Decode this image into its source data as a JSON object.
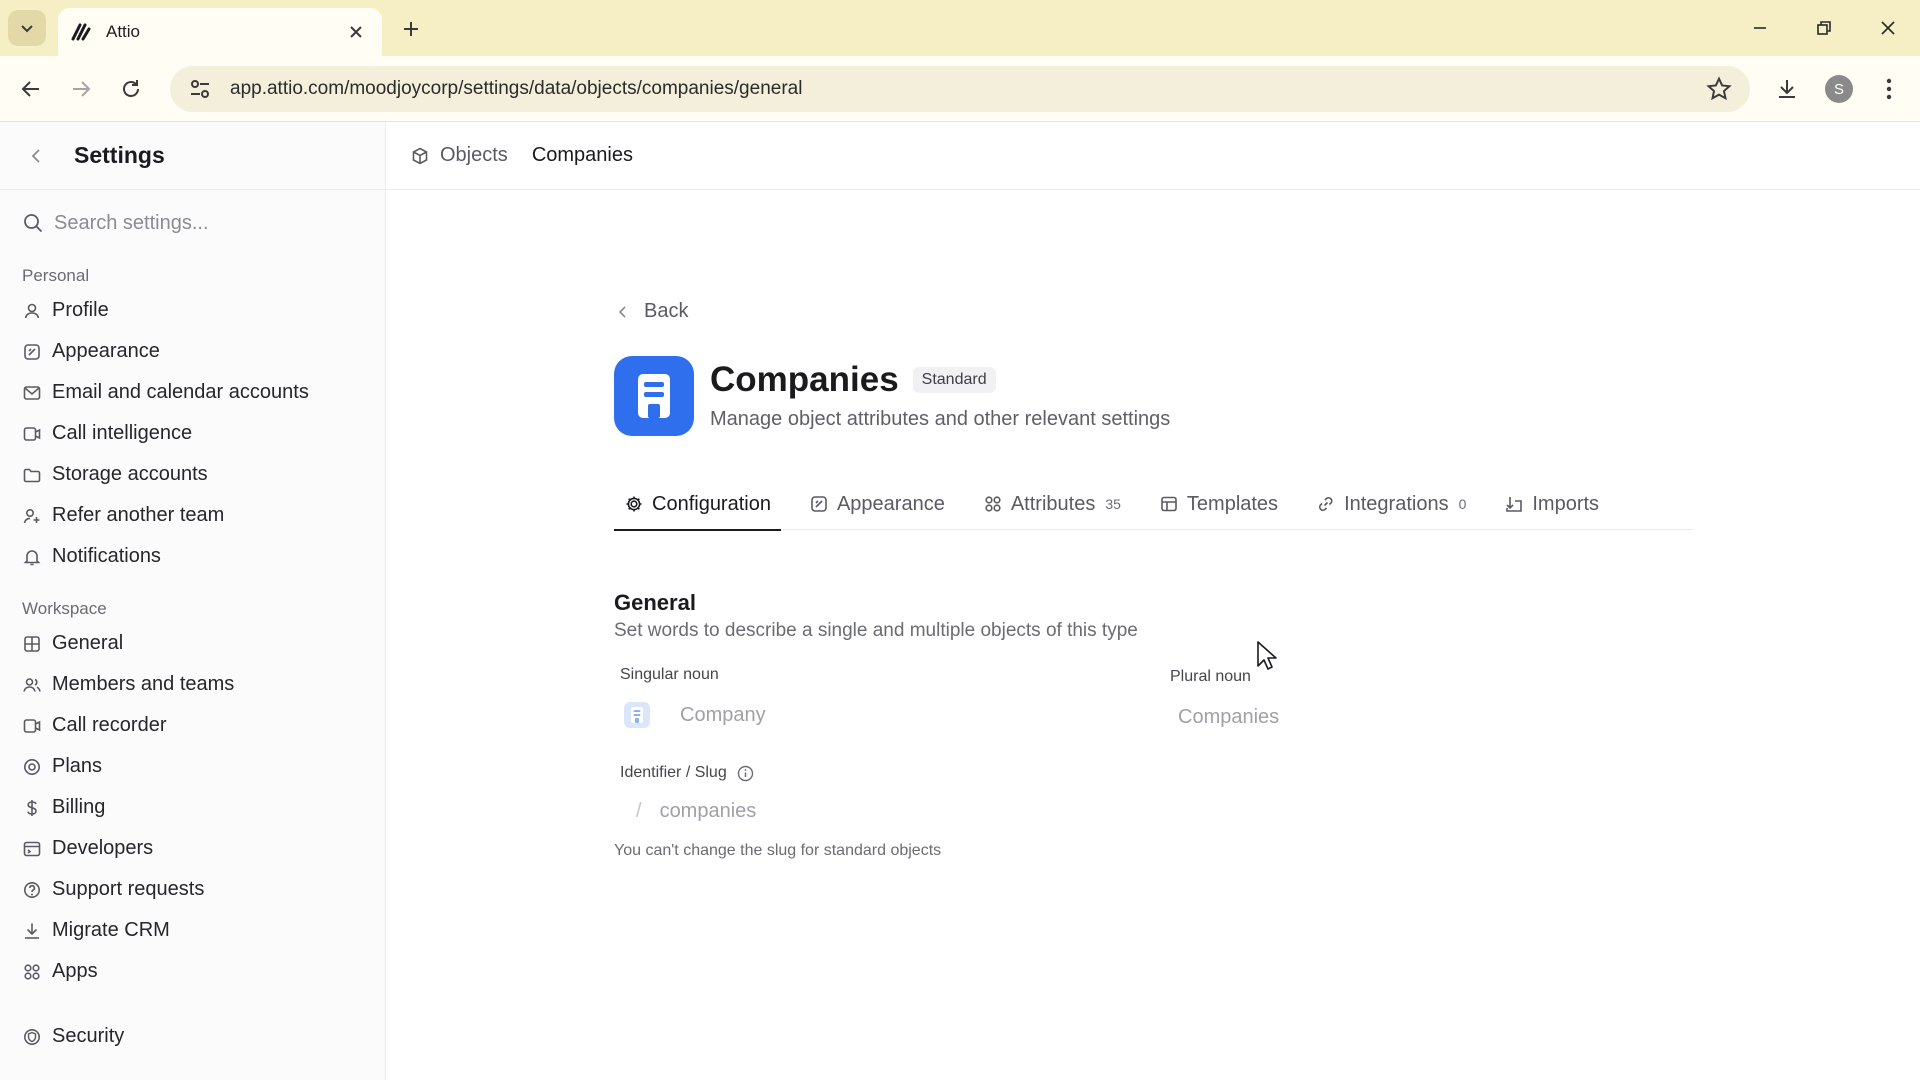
{
  "browser": {
    "tab_title": "Attio",
    "url": "app.attio.com/moodjoycorp/settings/data/objects/companies/general",
    "profile_initial": "S"
  },
  "sidebar": {
    "title": "Settings",
    "search_placeholder": "Search settings...",
    "personal_label": "Personal",
    "personal_items": [
      {
        "label": "Profile",
        "icon": "person-icon"
      },
      {
        "label": "Appearance",
        "icon": "appearance-icon"
      },
      {
        "label": "Email and calendar accounts",
        "icon": "mail-calendar-icon"
      },
      {
        "label": "Call intelligence",
        "icon": "call-intelligence-icon"
      },
      {
        "label": "Storage accounts",
        "icon": "storage-icon"
      },
      {
        "label": "Refer another team",
        "icon": "refer-icon"
      },
      {
        "label": "Notifications",
        "icon": "bell-icon"
      }
    ],
    "workspace_label": "Workspace",
    "workspace_items": [
      {
        "label": "General",
        "icon": "grid-icon"
      },
      {
        "label": "Members and teams",
        "icon": "members-icon"
      },
      {
        "label": "Call recorder",
        "icon": "call-recorder-icon"
      },
      {
        "label": "Plans",
        "icon": "plans-icon"
      },
      {
        "label": "Billing",
        "icon": "dollar-icon"
      },
      {
        "label": "Developers",
        "icon": "developers-icon"
      },
      {
        "label": "Support requests",
        "icon": "help-icon"
      },
      {
        "label": "Migrate CRM",
        "icon": "download-icon"
      },
      {
        "label": "Apps",
        "icon": "apps-icon"
      },
      {
        "label": "Security",
        "icon": "shield-icon"
      }
    ]
  },
  "breadcrumbs": {
    "objects": "Objects",
    "current": "Companies"
  },
  "page": {
    "back_label": "Back",
    "object_name": "Companies",
    "badge": "Standard",
    "subtitle": "Manage object attributes and other relevant settings",
    "accent_color": "#2f6fed"
  },
  "tabs": [
    {
      "label": "Configuration",
      "count": "",
      "icon": "gear-icon"
    },
    {
      "label": "Appearance",
      "count": "",
      "icon": "appearance-icon"
    },
    {
      "label": "Attributes",
      "count": "35",
      "icon": "attributes-icon"
    },
    {
      "label": "Templates",
      "count": "",
      "icon": "templates-icon"
    },
    {
      "label": "Integrations",
      "count": "0",
      "icon": "link-icon"
    },
    {
      "label": "Imports",
      "count": "",
      "icon": "import-icon"
    }
  ],
  "general": {
    "title": "General",
    "subtitle": "Set words to describe a single and multiple objects of this type",
    "singular_label": "Singular noun",
    "singular_value": "Company",
    "plural_label": "Plural noun",
    "plural_value": "Companies",
    "slug_label": "Identifier / Slug",
    "slug_prefix": "/",
    "slug_value": "companies",
    "slug_hint": "You can't change the slug for standard objects"
  }
}
